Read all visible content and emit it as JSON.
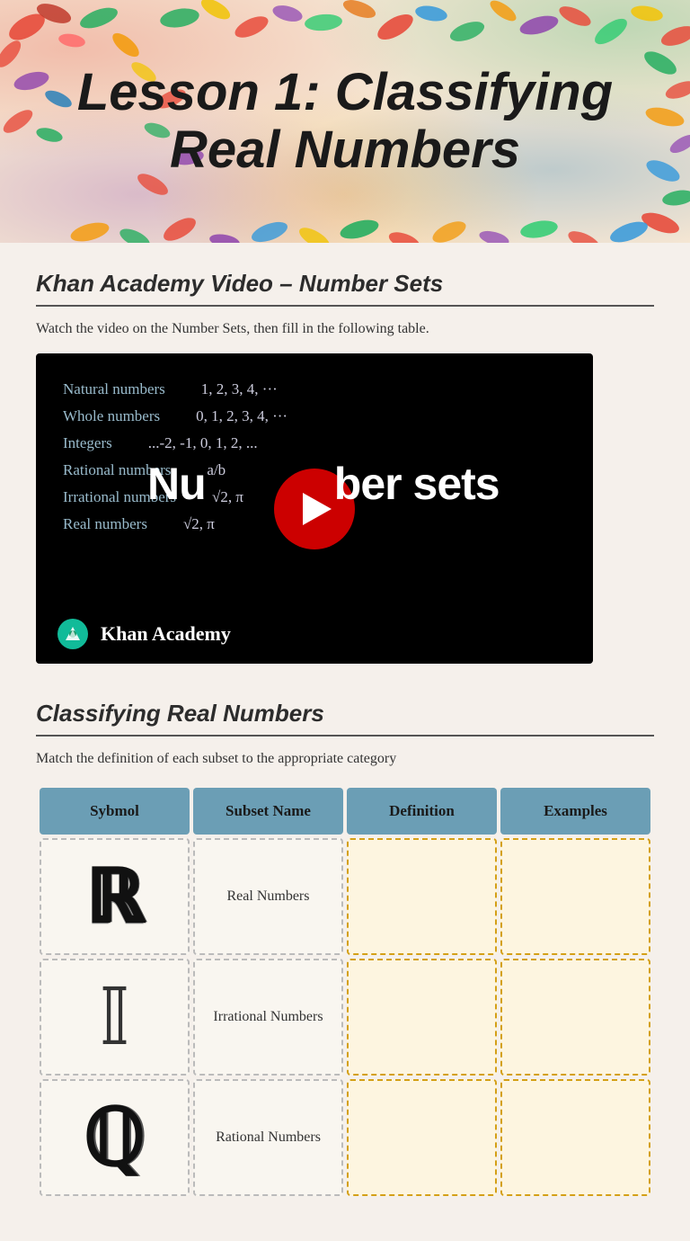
{
  "header": {
    "title": "Lesson 1: Classifying Real Numbers"
  },
  "section1": {
    "title": "Khan Academy Video – Number Sets",
    "description": "Watch the video on the Number Sets, then fill in the following table.",
    "video": {
      "label": "Number sets",
      "khan_label": "Khan Academy",
      "lines": [
        {
          "label": "Natural numbers",
          "value": "1, 2, 3, 4, ..."
        },
        {
          "label": "Whole numbers",
          "value": "0, 1, 2, 3, 4, ..."
        },
        {
          "label": "Integers",
          "value": "...-2, -1, 0, 1, 2, ..."
        },
        {
          "label": "Rational numbers",
          "value": "a/b"
        },
        {
          "label": "Irrational numbers",
          "value": "√2, π"
        },
        {
          "label": "Real numbers",
          "value": "√2, π"
        }
      ]
    }
  },
  "section2": {
    "title": "Classifying Real Numbers",
    "description": "Match the definition of each subset to the appropriate category",
    "table": {
      "headers": [
        "Sybmol",
        "Subset Name",
        "Definition",
        "Examples"
      ],
      "rows": [
        {
          "symbol": "ℝ",
          "symbol_display": "R",
          "subset_name": "Real Numbers",
          "definition": "",
          "examples": ""
        },
        {
          "symbol": "𝕀",
          "symbol_display": "I",
          "subset_name": "Irrational Numbers",
          "definition": "",
          "examples": ""
        },
        {
          "symbol": "ℚ",
          "symbol_display": "Q",
          "subset_name": "Rational Numbers",
          "definition": "",
          "examples": ""
        }
      ]
    }
  }
}
